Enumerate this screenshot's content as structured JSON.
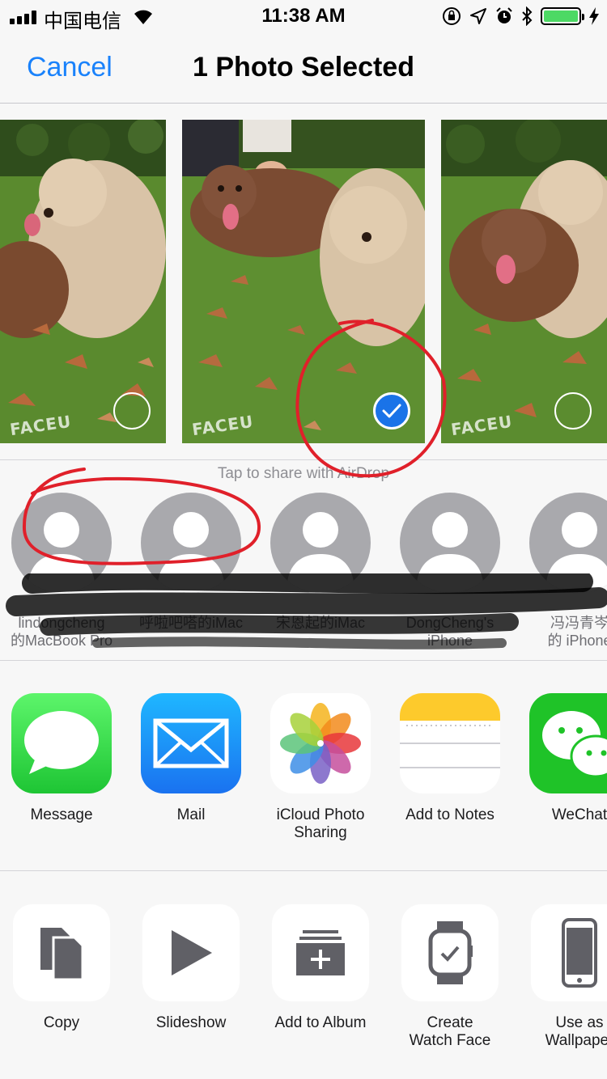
{
  "status_bar": {
    "carrier": "中国电信",
    "time": "11:38 AM"
  },
  "nav": {
    "cancel_label": "Cancel",
    "title": "1 Photo Selected"
  },
  "photos": [
    {
      "selected": false
    },
    {
      "selected": true
    },
    {
      "selected": false
    }
  ],
  "watermark": "FACEU",
  "airdrop": {
    "hint": "Tap to share with AirDrop",
    "people": [
      {
        "name": "lindongcheng\n的MacBook Pro"
      },
      {
        "name": "呼啦吧嗒的iMac"
      },
      {
        "name": "宋恩起的iMac"
      },
      {
        "name": "DongCheng's\niPhone"
      },
      {
        "name": "冯冯青岑\n的 iPhone"
      }
    ]
  },
  "apps": [
    {
      "label": "Message",
      "icon": "message-icon"
    },
    {
      "label": "Mail",
      "icon": "mail-icon"
    },
    {
      "label": "iCloud Photo\nSharing",
      "icon": "photos-icon"
    },
    {
      "label": "Add to Notes",
      "icon": "notes-icon"
    },
    {
      "label": "WeChat",
      "icon": "wechat-icon"
    }
  ],
  "actions": [
    {
      "label": "Copy",
      "icon": "copy-icon"
    },
    {
      "label": "Slideshow",
      "icon": "play-icon"
    },
    {
      "label": "Add to Album",
      "icon": "add-album-icon"
    },
    {
      "label": "Create\nWatch Face",
      "icon": "watch-icon"
    },
    {
      "label": "Use as\nWallpaper",
      "icon": "phone-icon"
    }
  ],
  "colors": {
    "accent": "#1a82fb",
    "annotation": "#e0202a",
    "battery": "#4cd964"
  }
}
